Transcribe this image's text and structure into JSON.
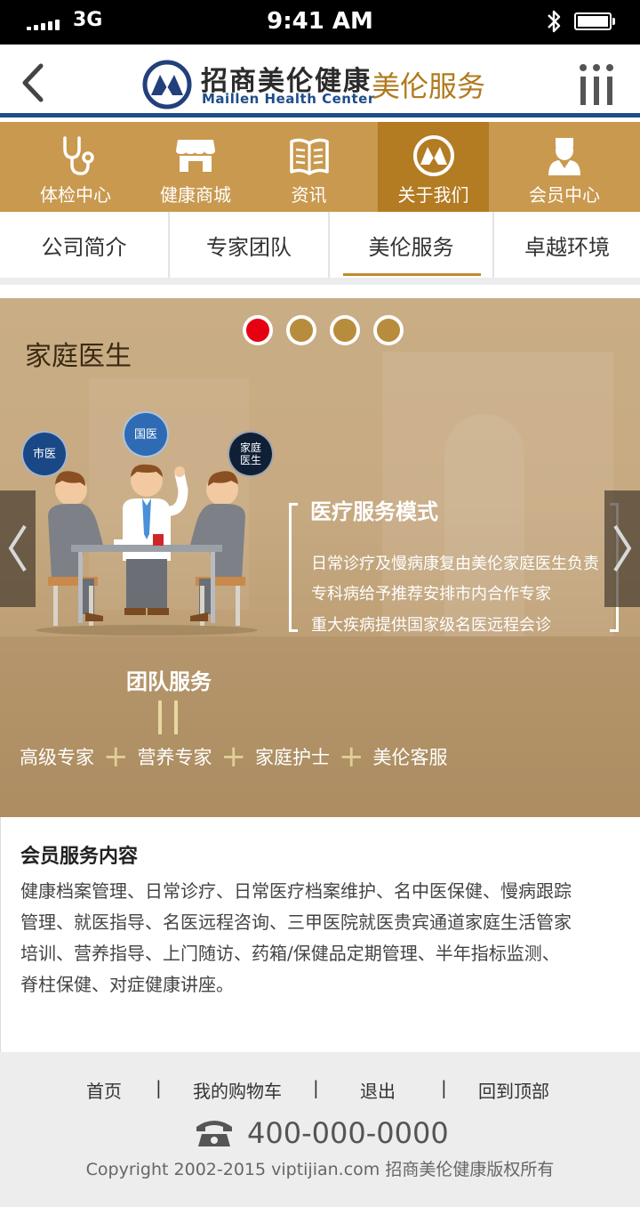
{
  "status_bar": {
    "carrier": "3G",
    "time": "9:41 AM"
  },
  "header": {
    "brand_cn": "招商美伦健康",
    "brand_en": "Maillen Health Center",
    "title": "美伦服务"
  },
  "main_nav": [
    {
      "label": "体检中心",
      "icon": "stethoscope-icon"
    },
    {
      "label": "健康商城",
      "icon": "store-icon"
    },
    {
      "label": "资讯",
      "icon": "book-icon"
    },
    {
      "label": "关于我们",
      "icon": "logo-icon",
      "active": true
    },
    {
      "label": "会员中心",
      "icon": "doctor-icon"
    }
  ],
  "sub_tabs": [
    {
      "label": "公司简介"
    },
    {
      "label": "专家团队"
    },
    {
      "label": "美伦服务",
      "active": true
    },
    {
      "label": "卓越环境"
    }
  ],
  "banner": {
    "title": "家庭医生",
    "slides_total": 4,
    "active_slide": 1,
    "badges": {
      "city": "市医",
      "national": "国医",
      "family_1": "家庭",
      "family_2": "医生"
    },
    "model_title": "医疗服务模式",
    "model_lines": [
      "日常诊疗及慢病康复由美伦家庭医生负责",
      "专科病给予推荐安排市内合作专家",
      "重大疾病提供国家级名医远程会诊"
    ],
    "team_title": "团队服务",
    "team_members": [
      "高级专家",
      "营养专家",
      "家庭护士",
      "美伦客服"
    ]
  },
  "content": {
    "title": "会员服务内容",
    "lines": [
      "健康档案管理、日常诊疗、日常医疗档案维护、名中医保健、慢病跟踪",
      "管理、就医指导、名医远程咨询、三甲医院就医贵宾通道家庭生活管家",
      "培训、营养指导、上门随访、药箱/保健品定期管理、半年指标监测、",
      "脊柱保健、对症健康讲座。"
    ]
  },
  "footer": {
    "links": [
      "首页",
      "我的购物车",
      "退出",
      "回到顶部"
    ],
    "separator": "|",
    "phone": "400-000-0000",
    "copyright": "Copyright 2002-2015 viptijian.com  招商美伦健康版权所有"
  },
  "colors": {
    "nav_bg": "#c9994f",
    "nav_active": "#b37b22",
    "accent_blue": "#1e4d8a",
    "title_gold": "#b07a1d",
    "dot_active": "#e60012"
  }
}
